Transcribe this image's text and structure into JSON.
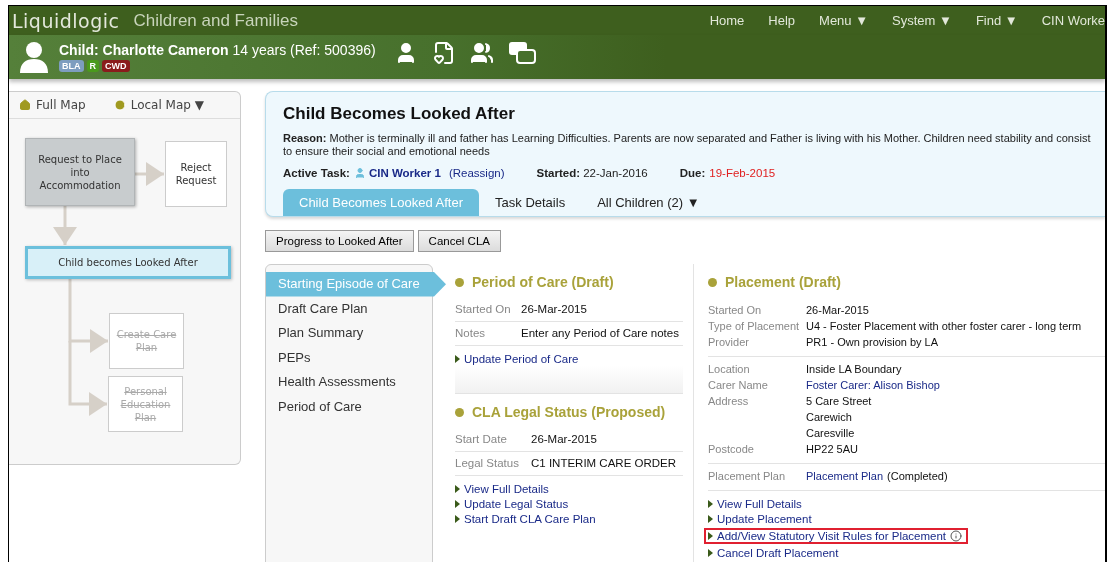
{
  "app": {
    "logo": "Liquidlogic",
    "title": "Children and Families",
    "nav": [
      "Home",
      "Help",
      "Menu ▼",
      "System ▼",
      "Find ▼",
      "CIN Worke"
    ]
  },
  "child": {
    "prefix": "Child:",
    "name": "Charlotte Cameron",
    "details": "14 years (Ref: 500396)",
    "badges": [
      {
        "label": "BLA",
        "color": "#7d9dbf"
      },
      {
        "label": "R",
        "color": "#4a9a1c"
      },
      {
        "label": "CWD",
        "color": "#8a1c1c"
      }
    ]
  },
  "map": {
    "full_map": "Full Map",
    "local_map": "Local Map ▼",
    "nodes": [
      {
        "label": "Request to Place into Accommodation",
        "kind": "done"
      },
      {
        "label": "Reject Request",
        "kind": "available"
      },
      {
        "label": "Child becomes Looked After",
        "kind": "current"
      },
      {
        "label": "Create Care Plan",
        "kind": "disabled"
      },
      {
        "label": "Personal Education Plan",
        "kind": "disabled"
      }
    ]
  },
  "task": {
    "title": "Child Becomes Looked After",
    "reason_label": "Reason:",
    "reason_lines": [
      "Mother is terminally ill and father has Learning Difficulties. Parents are now separated and Father is living with his Mother. Children need stability and consist",
      "to ensure their social and emotional needs"
    ],
    "active_task_label": "Active Task:",
    "worker": "CIN Worker 1",
    "reassign": "(Reassign)",
    "started_label": "Started:",
    "started": "22-Jan-2016",
    "due_label": "Due:",
    "due": "19-Feb-2015",
    "overdue": true,
    "tabs": [
      {
        "label": "Child Becomes Looked After",
        "selected": true
      },
      {
        "label": "Task Details",
        "selected": false
      },
      {
        "label": "All Children (2) ▼",
        "selected": false
      }
    ]
  },
  "actions": [
    "Progress to Looked After",
    "Cancel CLA"
  ],
  "side_nav": [
    {
      "label": "Starting Episode of Care",
      "selected": true
    },
    {
      "label": "Draft Care Plan",
      "selected": false
    },
    {
      "label": "Plan Summary",
      "selected": false
    },
    {
      "label": "PEPs",
      "selected": false
    },
    {
      "label": "Health Assessments",
      "selected": false
    },
    {
      "label": "Period of Care",
      "selected": false
    }
  ],
  "period_of_care": {
    "heading": "Period of Care (Draft)",
    "fields": [
      {
        "label": "Started On",
        "value": "26-Mar-2015"
      },
      {
        "label": "Notes",
        "value": "Enter any Period of Care notes"
      }
    ],
    "links": [
      {
        "label": "Update Period of Care",
        "highlighted": false
      }
    ]
  },
  "legal_status": {
    "heading": "CLA Legal Status (Proposed)",
    "fields": [
      {
        "label": "Start Date",
        "value": "26-Mar-2015"
      },
      {
        "label": "Legal Status",
        "value": "C1 INTERIM CARE ORDER"
      }
    ],
    "links": [
      {
        "label": "View Full Details",
        "highlighted": false
      },
      {
        "label": "Update Legal Status",
        "highlighted": false
      },
      {
        "label": "Start Draft CLA Care Plan",
        "highlighted": false
      }
    ]
  },
  "placement": {
    "heading": "Placement (Draft)",
    "groups": [
      [
        {
          "label": "Started On",
          "kind": "text",
          "value": "26-Mar-2015"
        },
        {
          "label": "Type of Placement",
          "kind": "text",
          "value": "U4 - Foster Placement with other foster carer - long term"
        },
        {
          "label": "Provider",
          "kind": "text",
          "value": "PR1 - Own provision by LA"
        }
      ],
      [
        {
          "label": "Location",
          "kind": "text",
          "value": "Inside LA Boundary"
        },
        {
          "label": "Carer Name",
          "kind": "link",
          "value": "Foster Carer: Alison Bishop"
        },
        {
          "label": "Address",
          "kind": "lines",
          "lines": [
            "5 Care Street",
            "Carewich",
            "Caresville"
          ]
        },
        {
          "label": "Postcode",
          "kind": "text",
          "value": "HP22 5AU"
        }
      ],
      [
        {
          "label": "Placement Plan",
          "kind": "link_note",
          "value": "Placement Plan",
          "note": "(Completed)"
        }
      ]
    ],
    "links": [
      {
        "label": "View Full Details",
        "highlighted": false
      },
      {
        "label": "Update Placement",
        "highlighted": false
      },
      {
        "label": "Add/View Statutory Visit Rules for Placement",
        "highlighted": true,
        "info": true
      },
      {
        "label": "Cancel Draft Placement",
        "highlighted": false
      }
    ]
  }
}
